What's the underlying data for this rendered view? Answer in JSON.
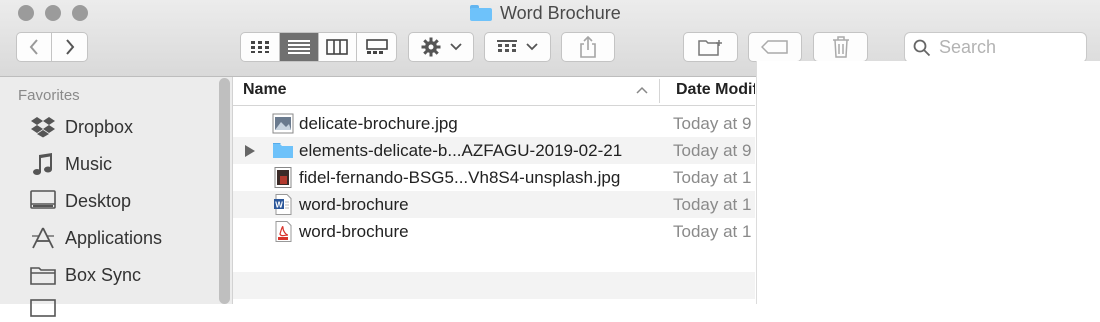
{
  "window": {
    "title": "Word Brochure"
  },
  "toolbar": {
    "search_placeholder": "Search",
    "view_modes": [
      "icon-view",
      "list-view",
      "column-view",
      "gallery-view"
    ],
    "active_view": "list-view"
  },
  "sidebar": {
    "header": "Favorites",
    "items": [
      {
        "label": "Dropbox",
        "icon": "dropbox-icon"
      },
      {
        "label": "Music",
        "icon": "music-note-icon"
      },
      {
        "label": "Desktop",
        "icon": "desktop-icon"
      },
      {
        "label": "Applications",
        "icon": "applications-icon"
      },
      {
        "label": "Box Sync",
        "icon": "folder-icon"
      }
    ]
  },
  "file_list": {
    "columns": {
      "name": "Name",
      "date": "Date Modif"
    },
    "rows": [
      {
        "name": "delicate-brochure.jpg",
        "date": "Today at 9",
        "icon": "image-file-icon"
      },
      {
        "name": "elements-delicate-b...AZFAGU-2019-02-21",
        "date": "Today at 9",
        "icon": "folder-icon",
        "expandable": true
      },
      {
        "name": "fidel-fernando-BSG5...Vh8S4-unsplash.jpg",
        "date": "Today at 1",
        "icon": "photo-file-icon"
      },
      {
        "name": "word-brochure",
        "date": "Today at 1",
        "icon": "word-doc-icon"
      },
      {
        "name": "word-brochure",
        "date": "Today at 1",
        "icon": "pdf-doc-icon"
      }
    ]
  },
  "colors": {
    "accent_folder": "#6ec2fa",
    "active_segment": "#707070"
  }
}
